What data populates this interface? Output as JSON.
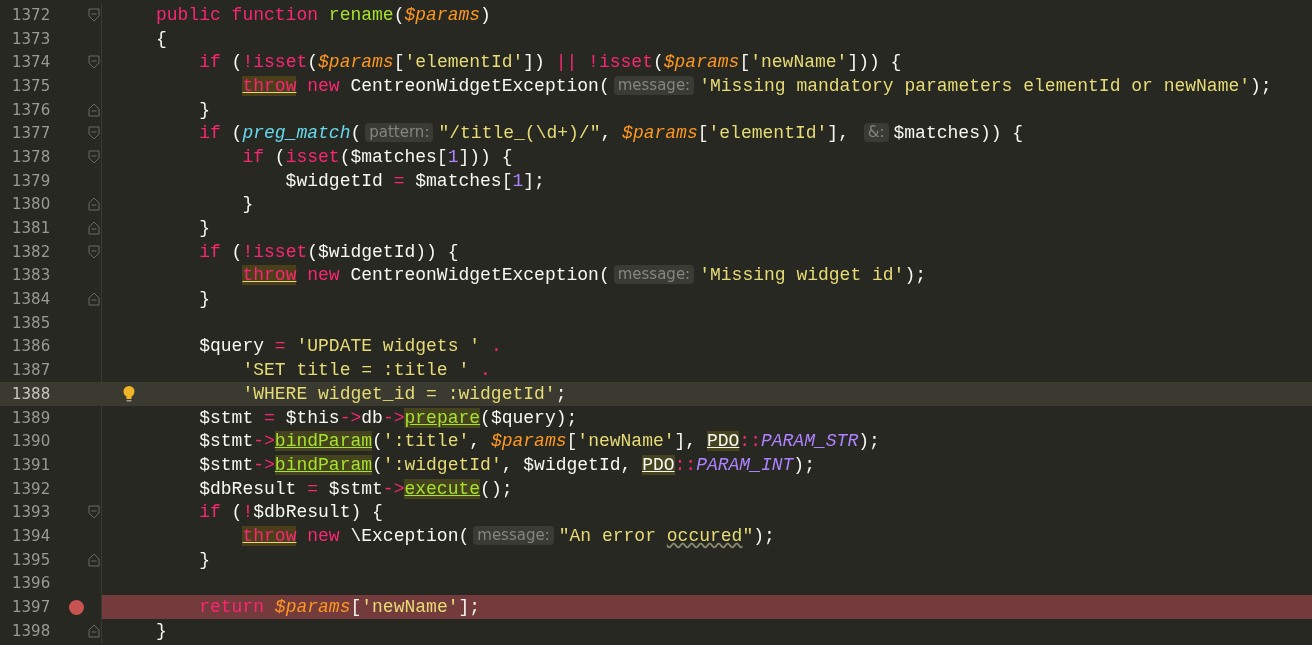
{
  "editor": {
    "lines": [
      {
        "number": "1372",
        "fold_start": true,
        "fold_end": false,
        "current": false,
        "breakpoint": false,
        "bulb": false,
        "tokens": [
          {
            "kind": "keyword",
            "text": "public function "
          },
          {
            "kind": "function-name",
            "text": "rename"
          },
          {
            "kind": "plain",
            "text": "("
          },
          {
            "kind": "param",
            "text": "$params"
          },
          {
            "kind": "plain",
            "text": ")"
          }
        ]
      },
      {
        "number": "1373",
        "fold_start": false,
        "fold_end": false,
        "current": false,
        "breakpoint": false,
        "bulb": false,
        "tokens": [
          {
            "kind": "plain",
            "text": "{"
          }
        ]
      },
      {
        "number": "1374",
        "fold_start": true,
        "fold_end": false,
        "current": false,
        "breakpoint": false,
        "bulb": false,
        "tokens": [
          {
            "kind": "keyword",
            "text": "    if"
          },
          {
            "kind": "plain",
            "text": " ("
          },
          {
            "kind": "keyword",
            "text": "!isset"
          },
          {
            "kind": "plain",
            "text": "("
          },
          {
            "kind": "param",
            "text": "$params"
          },
          {
            "kind": "plain",
            "text": "["
          },
          {
            "kind": "string",
            "text": "'elementId'"
          },
          {
            "kind": "plain",
            "text": "]) "
          },
          {
            "kind": "keyword",
            "text": "|| !isset"
          },
          {
            "kind": "plain",
            "text": "("
          },
          {
            "kind": "param",
            "text": "$params"
          },
          {
            "kind": "plain",
            "text": "["
          },
          {
            "kind": "string",
            "text": "'newName'"
          },
          {
            "kind": "plain",
            "text": "])) {"
          }
        ]
      },
      {
        "number": "1375",
        "fold_start": false,
        "fold_end": false,
        "current": false,
        "breakpoint": false,
        "bulb": false,
        "tokens": [
          {
            "kind": "warning-keyword",
            "text": "        throw"
          },
          {
            "kind": "keyword",
            "text": " new"
          },
          {
            "kind": "plain",
            "text": " CentreonWidgetException("
          },
          {
            "kind": "hint",
            "text": "message:"
          },
          {
            "kind": "string",
            "text": "'Missing mandatory parameters elementId or newName'"
          },
          {
            "kind": "plain",
            "text": ");"
          }
        ]
      },
      {
        "number": "1376",
        "fold_start": false,
        "fold_end": true,
        "current": false,
        "breakpoint": false,
        "bulb": false,
        "tokens": [
          {
            "kind": "plain",
            "text": "    }"
          }
        ]
      },
      {
        "number": "1377",
        "fold_start": true,
        "fold_end": false,
        "current": false,
        "breakpoint": false,
        "bulb": false,
        "tokens": [
          {
            "kind": "keyword",
            "text": "    if"
          },
          {
            "kind": "plain",
            "text": " ("
          },
          {
            "kind": "builtin-call",
            "text": "preg_match"
          },
          {
            "kind": "plain",
            "text": "("
          },
          {
            "kind": "hint",
            "text": "pattern:"
          },
          {
            "kind": "string",
            "text": "\"/title_(\\d+)/\""
          },
          {
            "kind": "plain",
            "text": ", "
          },
          {
            "kind": "param",
            "text": "$params"
          },
          {
            "kind": "plain",
            "text": "["
          },
          {
            "kind": "string",
            "text": "'elementId'"
          },
          {
            "kind": "plain",
            "text": "], "
          },
          {
            "kind": "hint",
            "text": "&:"
          },
          {
            "kind": "plain",
            "text": "$matches)) {"
          }
        ]
      },
      {
        "number": "1378",
        "fold_start": true,
        "fold_end": false,
        "current": false,
        "breakpoint": false,
        "bulb": false,
        "tokens": [
          {
            "kind": "keyword",
            "text": "        if"
          },
          {
            "kind": "plain",
            "text": " ("
          },
          {
            "kind": "keyword",
            "text": "isset"
          },
          {
            "kind": "plain",
            "text": "($matches["
          },
          {
            "kind": "number",
            "text": "1"
          },
          {
            "kind": "plain",
            "text": "])) {"
          }
        ]
      },
      {
        "number": "1379",
        "fold_start": false,
        "fold_end": false,
        "current": false,
        "breakpoint": false,
        "bulb": false,
        "tokens": [
          {
            "kind": "plain",
            "text": "            $widgetId "
          },
          {
            "kind": "keyword",
            "text": "="
          },
          {
            "kind": "plain",
            "text": " $matches["
          },
          {
            "kind": "number",
            "text": "1"
          },
          {
            "kind": "plain",
            "text": "];"
          }
        ]
      },
      {
        "number": "1380",
        "fold_start": false,
        "fold_end": true,
        "current": false,
        "breakpoint": false,
        "bulb": false,
        "tokens": [
          {
            "kind": "plain",
            "text": "        }"
          }
        ]
      },
      {
        "number": "1381",
        "fold_start": false,
        "fold_end": true,
        "current": false,
        "breakpoint": false,
        "bulb": false,
        "tokens": [
          {
            "kind": "plain",
            "text": "    }"
          }
        ]
      },
      {
        "number": "1382",
        "fold_start": true,
        "fold_end": false,
        "current": false,
        "breakpoint": false,
        "bulb": false,
        "tokens": [
          {
            "kind": "keyword",
            "text": "    if"
          },
          {
            "kind": "plain",
            "text": " ("
          },
          {
            "kind": "keyword",
            "text": "!isset"
          },
          {
            "kind": "plain",
            "text": "($widgetId)) {"
          }
        ]
      },
      {
        "number": "1383",
        "fold_start": false,
        "fold_end": false,
        "current": false,
        "breakpoint": false,
        "bulb": false,
        "tokens": [
          {
            "kind": "warning-keyword",
            "text": "        throw"
          },
          {
            "kind": "keyword",
            "text": " new"
          },
          {
            "kind": "plain",
            "text": " CentreonWidgetException("
          },
          {
            "kind": "hint",
            "text": "message:"
          },
          {
            "kind": "string",
            "text": "'Missing widget id'"
          },
          {
            "kind": "plain",
            "text": ");"
          }
        ]
      },
      {
        "number": "1384",
        "fold_start": false,
        "fold_end": true,
        "current": false,
        "breakpoint": false,
        "bulb": false,
        "tokens": [
          {
            "kind": "plain",
            "text": "    }"
          }
        ]
      },
      {
        "number": "1385",
        "fold_start": false,
        "fold_end": false,
        "current": false,
        "breakpoint": false,
        "bulb": false
      },
      {
        "number": "1386",
        "fold_start": false,
        "fold_end": false,
        "current": false,
        "breakpoint": false,
        "bulb": false,
        "tokens": [
          {
            "kind": "plain",
            "text": "    $query "
          },
          {
            "kind": "keyword",
            "text": "="
          },
          {
            "kind": "string",
            "text": " 'UPDATE widgets '"
          },
          {
            "kind": "keyword",
            "text": " ."
          }
        ]
      },
      {
        "number": "1387",
        "fold_start": false,
        "fold_end": false,
        "current": false,
        "breakpoint": false,
        "bulb": false,
        "tokens": [
          {
            "kind": "string",
            "text": "        'SET title = :title '"
          },
          {
            "kind": "keyword",
            "text": " ."
          }
        ]
      },
      {
        "number": "1388",
        "fold_start": false,
        "fold_end": false,
        "current": true,
        "breakpoint": false,
        "bulb": true,
        "tokens": [
          {
            "kind": "string",
            "text": "        'WHERE widget_id = :widgetId'"
          },
          {
            "kind": "plain",
            "text": ";"
          }
        ]
      },
      {
        "number": "1389",
        "fold_start": false,
        "fold_end": false,
        "current": false,
        "breakpoint": false,
        "bulb": false,
        "tokens": [
          {
            "kind": "plain",
            "text": "    $stmt "
          },
          {
            "kind": "keyword",
            "text": "="
          },
          {
            "kind": "plain",
            "text": " $this"
          },
          {
            "kind": "keyword",
            "text": "->"
          },
          {
            "kind": "plain",
            "text": "db"
          },
          {
            "kind": "keyword",
            "text": "->"
          },
          {
            "kind": "method",
            "text": "prepare"
          },
          {
            "kind": "plain",
            "text": "($query);"
          }
        ]
      },
      {
        "number": "1390",
        "fold_start": false,
        "fold_end": false,
        "current": false,
        "breakpoint": false,
        "bulb": false,
        "tokens": [
          {
            "kind": "plain",
            "text": "    $stmt"
          },
          {
            "kind": "keyword",
            "text": "->"
          },
          {
            "kind": "method",
            "text": "bindParam"
          },
          {
            "kind": "plain",
            "text": "("
          },
          {
            "kind": "string",
            "text": "':title'"
          },
          {
            "kind": "plain",
            "text": ", "
          },
          {
            "kind": "param",
            "text": "$params"
          },
          {
            "kind": "plain",
            "text": "["
          },
          {
            "kind": "string",
            "text": "'newName'"
          },
          {
            "kind": "plain",
            "text": "], "
          },
          {
            "kind": "class-ref",
            "text": "PDO"
          },
          {
            "kind": "keyword",
            "text": "::"
          },
          {
            "kind": "constant",
            "text": "PARAM_STR"
          },
          {
            "kind": "plain",
            "text": ");"
          }
        ]
      },
      {
        "number": "1391",
        "fold_start": false,
        "fold_end": false,
        "current": false,
        "breakpoint": false,
        "bulb": false,
        "tokens": [
          {
            "kind": "plain",
            "text": "    $stmt"
          },
          {
            "kind": "keyword",
            "text": "->"
          },
          {
            "kind": "method",
            "text": "bindParam"
          },
          {
            "kind": "plain",
            "text": "("
          },
          {
            "kind": "string",
            "text": "':widgetId'"
          },
          {
            "kind": "plain",
            "text": ", $widgetId, "
          },
          {
            "kind": "class-ref",
            "text": "PDO"
          },
          {
            "kind": "keyword",
            "text": "::"
          },
          {
            "kind": "constant",
            "text": "PARAM_INT"
          },
          {
            "kind": "plain",
            "text": ");"
          }
        ]
      },
      {
        "number": "1392",
        "fold_start": false,
        "fold_end": false,
        "current": false,
        "breakpoint": false,
        "bulb": false,
        "tokens": [
          {
            "kind": "plain",
            "text": "    $dbResult "
          },
          {
            "kind": "keyword",
            "text": "="
          },
          {
            "kind": "plain",
            "text": " $stmt"
          },
          {
            "kind": "keyword",
            "text": "->"
          },
          {
            "kind": "method",
            "text": "execute"
          },
          {
            "kind": "plain",
            "text": "();"
          }
        ]
      },
      {
        "number": "1393",
        "fold_start": true,
        "fold_end": false,
        "current": false,
        "breakpoint": false,
        "bulb": false,
        "tokens": [
          {
            "kind": "keyword",
            "text": "    if"
          },
          {
            "kind": "plain",
            "text": " ("
          },
          {
            "kind": "keyword",
            "text": "!"
          },
          {
            "kind": "plain",
            "text": "$dbResult) {"
          }
        ]
      },
      {
        "number": "1394",
        "fold_start": false,
        "fold_end": false,
        "current": false,
        "breakpoint": false,
        "bulb": false,
        "tokens": [
          {
            "kind": "warning-keyword",
            "text": "        throw"
          },
          {
            "kind": "keyword",
            "text": " new"
          },
          {
            "kind": "plain",
            "text": " \\Exception("
          },
          {
            "kind": "hint",
            "text": "message:"
          },
          {
            "kind": "string",
            "text": "\"An error "
          },
          {
            "kind": "typo",
            "text": "occured"
          },
          {
            "kind": "string",
            "text": "\""
          },
          {
            "kind": "plain",
            "text": ");"
          }
        ]
      },
      {
        "number": "1395",
        "fold_start": false,
        "fold_end": true,
        "current": false,
        "breakpoint": false,
        "bulb": false,
        "tokens": [
          {
            "kind": "plain",
            "text": "    }"
          }
        ]
      },
      {
        "number": "1396",
        "fold_start": false,
        "fold_end": false,
        "current": false,
        "breakpoint": false,
        "bulb": false
      },
      {
        "number": "1397",
        "fold_start": false,
        "fold_end": false,
        "current": false,
        "breakpoint": true,
        "bulb": false,
        "tokens": [
          {
            "kind": "keyword",
            "text": "    return"
          },
          {
            "kind": "param",
            "text": " $params"
          },
          {
            "kind": "plain",
            "text": "["
          },
          {
            "kind": "string",
            "text": "'newName'"
          },
          {
            "kind": "plain",
            "text": "];"
          }
        ]
      },
      {
        "number": "1398",
        "fold_start": false,
        "fold_end": true,
        "current": false,
        "breakpoint": false,
        "bulb": false,
        "tokens": [
          {
            "kind": "plain",
            "text": "}"
          }
        ]
      }
    ]
  }
}
